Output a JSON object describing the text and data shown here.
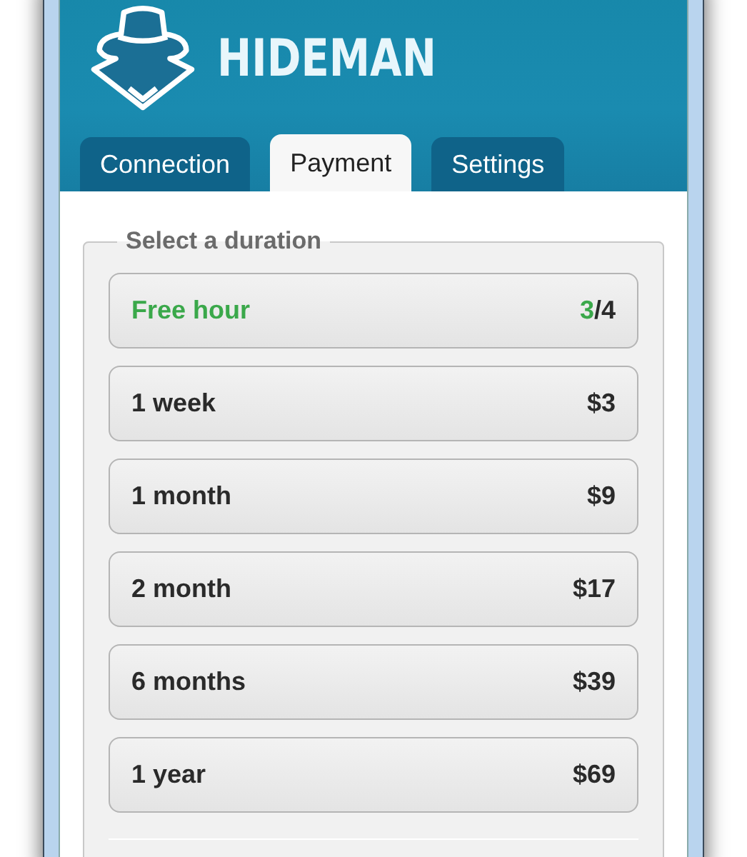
{
  "app": {
    "name": "HIDEMAN"
  },
  "tabs": [
    {
      "label": "Connection",
      "selected": false
    },
    {
      "label": "Payment",
      "selected": true
    },
    {
      "label": "Settings",
      "selected": false
    }
  ],
  "duration_group": {
    "title": "Select a duration"
  },
  "options": [
    {
      "kind": "free",
      "label": "Free hour",
      "used": "3",
      "limit": "/4"
    },
    {
      "kind": "paid",
      "label": "1 week",
      "price": "$3"
    },
    {
      "kind": "paid",
      "label": "1 month",
      "price": "$9"
    },
    {
      "kind": "paid",
      "label": "2 month",
      "price": "$17"
    },
    {
      "kind": "paid",
      "label": "6 months",
      "price": "$39"
    },
    {
      "kind": "paid",
      "label": "1 year",
      "price": "$69"
    }
  ]
}
